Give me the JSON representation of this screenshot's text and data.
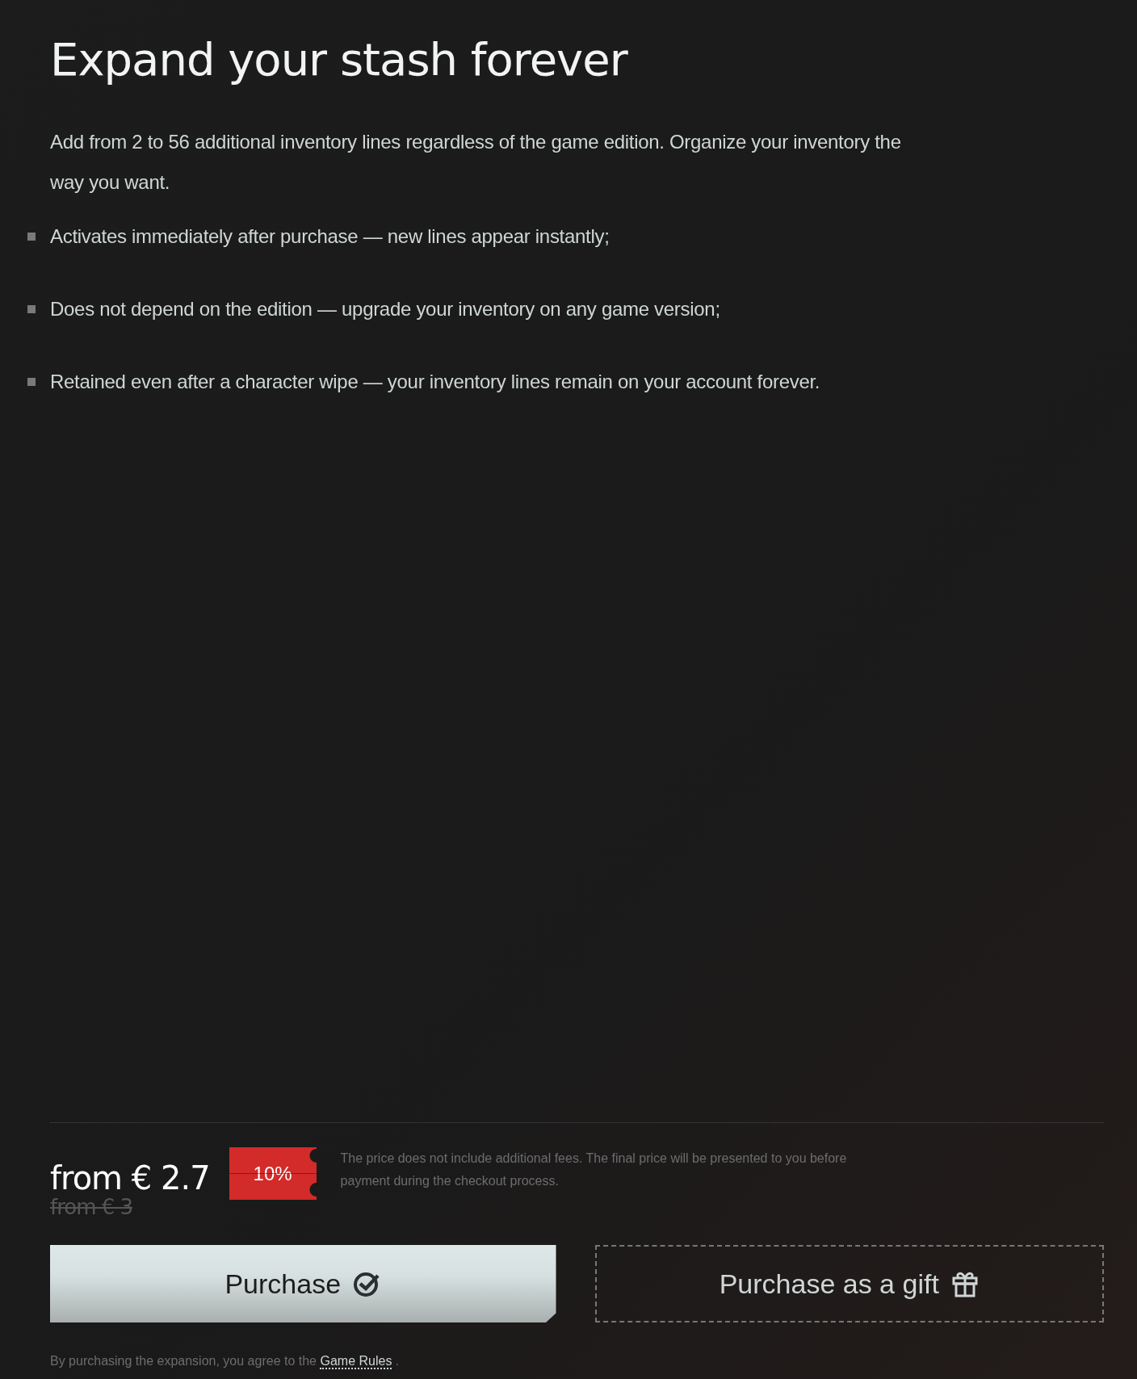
{
  "title": "Expand your stash forever",
  "description": "Add from 2 to 56 additional inventory lines regardless of the game edition. Organize your inventory the way you want.",
  "features": [
    "Activates immediately after purchase — new lines appear instantly;",
    "Does not depend on the edition — upgrade your inventory on any game version;",
    "Retained even after a character wipe — your inventory lines remain on your account forever."
  ],
  "price": {
    "current": "from € 2.7",
    "old": "from € 3",
    "discount": "10%",
    "note": "The price does not include additional fees. The final price will be presented to you before payment during the checkout process."
  },
  "buttons": [
    {
      "label": "Purchase",
      "kind": "primary"
    },
    {
      "label": "Purchase as a gift",
      "kind": "gift"
    }
  ],
  "agreement": {
    "text": "By purchasing the expansion, you agree to the",
    "link": "Game Rules",
    "after": "."
  }
}
